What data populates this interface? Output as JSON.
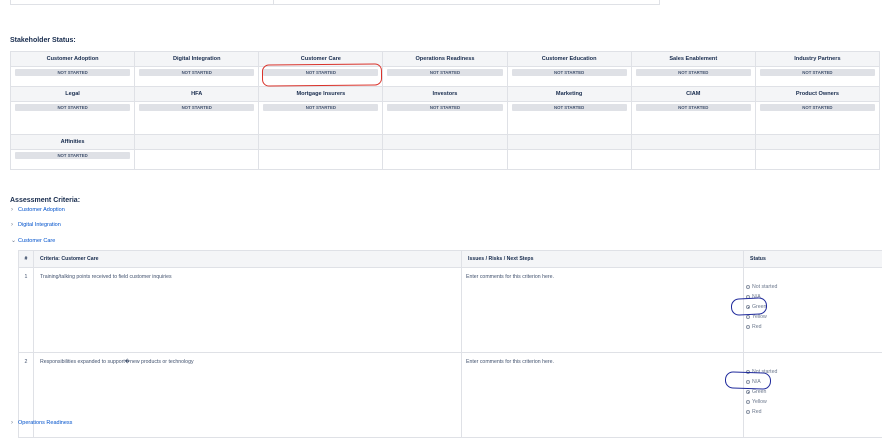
{
  "stakeholders": {
    "title": "Stakeholder Status:",
    "rows": [
      [
        {
          "name": "Customer Adoption",
          "status": "NOT STARTED"
        },
        {
          "name": "Digital Integration",
          "status": "NOT STARTED"
        },
        {
          "name": "Customer Care",
          "status": "NOT STARTED"
        },
        {
          "name": "Operations Readiness",
          "status": "NOT STARTED"
        },
        {
          "name": "Customer Education",
          "status": "NOT STARTED"
        },
        {
          "name": "Sales Enablement",
          "status": "NOT STARTED"
        },
        {
          "name": "Industry Partners",
          "status": "NOT STARTED"
        }
      ],
      [
        {
          "name": "Legal",
          "status": "NOT STARTED"
        },
        {
          "name": "HFA",
          "status": "NOT STARTED"
        },
        {
          "name": "Mortgage Insurers",
          "status": "NOT STARTED"
        },
        {
          "name": "Investors",
          "status": "NOT STARTED"
        },
        {
          "name": "Marketing",
          "status": "NOT STARTED"
        },
        {
          "name": "CIAM",
          "status": "NOT STARTED"
        },
        {
          "name": "Product Owners",
          "status": "NOT STARTED"
        }
      ],
      [
        {
          "name": "Affinities",
          "status": "NOT STARTED"
        }
      ]
    ]
  },
  "assessment": {
    "title": "Assessment Criteria:",
    "sections": [
      {
        "label": "Customer Adoption",
        "chevron": "›"
      },
      {
        "label": "Digital Integration",
        "chevron": "›"
      },
      {
        "label": "Customer Care",
        "chevron": "⌄"
      }
    ],
    "after_section": {
      "label": "Operations Readiness",
      "chevron": "›"
    },
    "table": {
      "headers": [
        "#",
        "Criteria: Customer Care",
        "Issues / Risks / Next Steps",
        "Status"
      ],
      "rows": [
        {
          "num": "1",
          "criteria": "Training/talking points received to field customer inquiries",
          "comment": "Enter comments for this criterion here.",
          "selected": "Green"
        },
        {
          "num": "2",
          "criteria": "Responsibilities expanded to support�new products or technology",
          "comment": "Enter comments for this criterion here.",
          "selected": "Green"
        }
      ],
      "status_options": [
        "Not started",
        "N/A",
        "Green",
        "Yellow",
        "Red"
      ]
    }
  }
}
